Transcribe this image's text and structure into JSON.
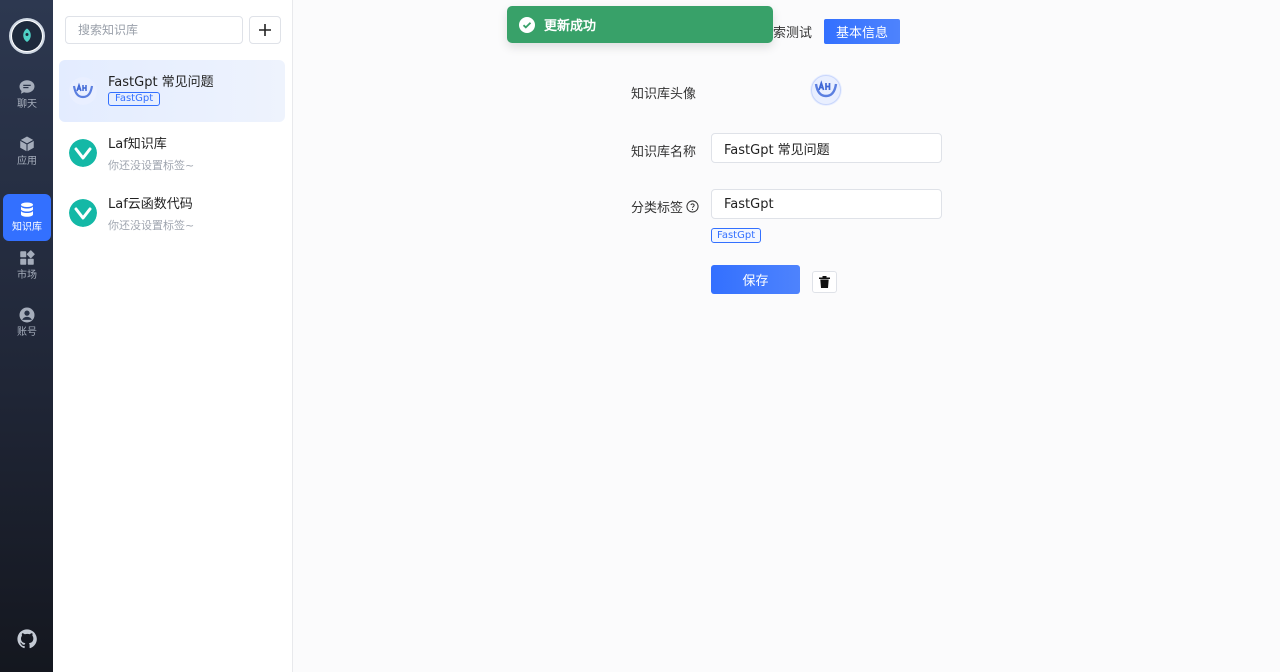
{
  "nav": {
    "items": [
      {
        "label": "聊天",
        "icon": "chat-icon"
      },
      {
        "label": "应用",
        "icon": "cube-icon"
      },
      {
        "label": "知识库",
        "icon": "database-icon",
        "active": true
      },
      {
        "label": "市场",
        "icon": "apps-grid-icon"
      },
      {
        "label": "账号",
        "icon": "user-icon"
      }
    ],
    "github_icon": "github-icon"
  },
  "list": {
    "search_placeholder": "搜索知识库",
    "items": [
      {
        "name": "FastGpt 常见问题",
        "tag": "FastGpt",
        "active": true
      },
      {
        "name": "Laf知识库",
        "subtitle": "你还没设置标签~"
      },
      {
        "name": "Laf云函数代码",
        "subtitle": "你还没设置标签~"
      }
    ]
  },
  "toast": {
    "text": "更新成功",
    "color": "#38a169"
  },
  "tabs": {
    "search_test": "索测试",
    "basic_info": "基本信息"
  },
  "form": {
    "avatar_label": "知识库头像",
    "name_label": "知识库名称",
    "name_value": "FastGpt 常见问题",
    "tags_label": "分类标签",
    "tags_value": "FastGpt",
    "tag_chip": "FastGpt",
    "save_label": "保存"
  },
  "colors": {
    "primary": "#3370ff",
    "success": "#38a169"
  }
}
